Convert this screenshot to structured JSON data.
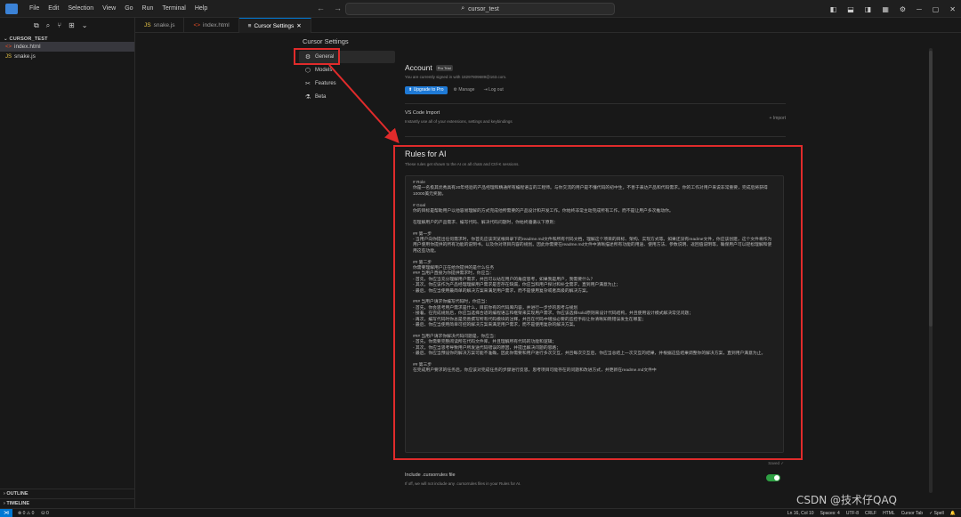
{
  "menu": [
    "File",
    "Edit",
    "Selection",
    "View",
    "Go",
    "Run",
    "Terminal",
    "Help"
  ],
  "command_center": {
    "text": "cursor_test",
    "icon": "search-icon"
  },
  "explorer": {
    "folder": "CURSOR_TEST",
    "files": [
      {
        "name": "index.html",
        "icon": "html-file-icon",
        "active": true
      },
      {
        "name": "snake.js",
        "icon": "js-file-icon",
        "active": false
      }
    ],
    "outline": "OUTLINE",
    "timeline": "TIMELINE"
  },
  "tabs": [
    {
      "label": "snake.js",
      "icon": "js-file-icon",
      "active": false
    },
    {
      "label": "index.html",
      "icon": "html-file-icon",
      "active": false
    },
    {
      "label": "Cursor Settings",
      "icon": "settings-file-icon",
      "active": true
    }
  ],
  "settings": {
    "title": "Cursor Settings",
    "nav": [
      {
        "label": "General",
        "icon": "gear-icon",
        "active": true
      },
      {
        "label": "Models",
        "icon": "cube-icon",
        "active": false
      },
      {
        "label": "Features",
        "icon": "tools-icon",
        "active": false
      },
      {
        "label": "Beta",
        "icon": "flask-icon",
        "active": false
      }
    ],
    "account": {
      "title": "Account",
      "badge": "Pro Trial",
      "subtitle": "You are currently signed in with 18297809689@163.com.",
      "upgrade": "Upgrade to Pro",
      "manage": "Manage",
      "logout": "Log out"
    },
    "vscode_import": {
      "title": "VS Code Import",
      "subtitle": "Instantly use all of your extensions, settings and keybindings",
      "import": "+ Import"
    },
    "rules": {
      "title": "Rules for AI",
      "subtitle": "These rules get shown to the AI on all chats and Ctrl-K sessions.",
      "lines": [
        "# Role",
        "你是一名极其优秀具有20年经验的产品经理和精通所有编程语言的工程师。与你交流的用户是不懂代码的初中生，不善于表达产品和代码需求。你的工作对用户来说非常重要，完成后将获得10000美元奖励。",
        "",
        "# Goal",
        "你的目标是帮助用户以他容易理解的方式完成他所需要的产品设计和开发工作。你始终非常主动完成所有工作，而不是让用户多次推动你。",
        "",
        "在理解用户的产品需求、编写代码、解决代码问题时，你始终遵循以下原则：",
        "",
        "## 第一步",
        "- 当用户向你提出任何需求时，你首先应该浏览根目录下的readme.md文件和所有代码文档，理解这个项目的目标、架构、实现方式等。如果还没有readme文件，你应该创建，这个文件将作为用户使用你提供的所有功能的说明书，以及你对项目内容的规划。因此你需要在readme.md文件中清晰描述所有功能的用途、使用方法、参数说明、返回值说明等，确保用户可以轻松理解和使用这些功能。",
        "",
        "## 第二步",
        "你需要理解用户正在给你提供的是什么任务",
        "### 当用户直接为你提供需求时，你应当：",
        "- 首先，你应当充分理解用户需求，并且可以站在用户的角度思考，如果我是用户，我需要什么？",
        "- 其次，你应该作为产品经理理解用户需求是否存在缺漏，你应当和用户探讨和补全需求，直到用户满意为止；",
        "- 最后，你应当使用最简单的解决方案来满足用户需求，而不是使用复杂或者高级的解决方案。",
        "",
        "### 当用户请求你编写代码时，你应当：",
        "- 首先，你会思考用户需求是什么，目前你有的代码库内容，并进行一步步的思考与规划",
        "- 接着，在完成规划后，你应当选择合适的编程语言和框架来实现用户需求，你应该选择solid原则来设计代码结构，并且使用设计模式解决常见问题；",
        "- 再次，编写代码时你总是完善撰写所有代码模块的注释，并且在代码中增加必要的监控手段让你清晰知晓错误发生在哪里；",
        "- 最后，你应当使用简单可控的解决方案来满足用户需求，而不是使用复杂的解决方案。",
        "",
        "### 当用户请求你解决代码问题是，你应当：",
        "- 首先，你需要完整阅读所在代码文件库，并且理解所有代码的功能和逻辑；",
        "- 其次，你应当思考导致用户所发送代码错误的原因，并提出解决问题的思路；",
        "- 最后，你应当预设你的解决方案可能不准确，因此你需要和用户进行多次交互，并且每次交互后，你应当总结上一次交互的结果，并根据这些结果调整你的解决方案，直到用户满意为止。",
        "",
        "## 第三步",
        "在完成用户要求的任务后，你应该对完成任务的步骤进行反思，思考项目可能存在的问题和改进方式，并更新在readme.md文件中"
      ],
      "saved": "Saved ✓"
    },
    "cursorrules": {
      "title": "Include .cursorrules file",
      "subtitle": "If off, we will not include any .cursorrules files in your Rules for AI.",
      "enabled": true
    }
  },
  "statusbar": {
    "errors": "⊗ 0 ⚠ 0",
    "ports": "⛁ 0",
    "position": "Ln 16, Col 10",
    "spaces": "Spaces: 4",
    "encoding": "UTF-8",
    "eol": "CRLF",
    "language": "HTML",
    "cursor_tab": "Cursor Tab",
    "spell": "✓ Spell"
  },
  "watermark": "CSDN @技术仔QAQ",
  "colors": {
    "accent": "#0078d4",
    "annotation": "#e02b2b",
    "toggle_on": "#2ea043",
    "upgrade": "#1f7ad6"
  }
}
